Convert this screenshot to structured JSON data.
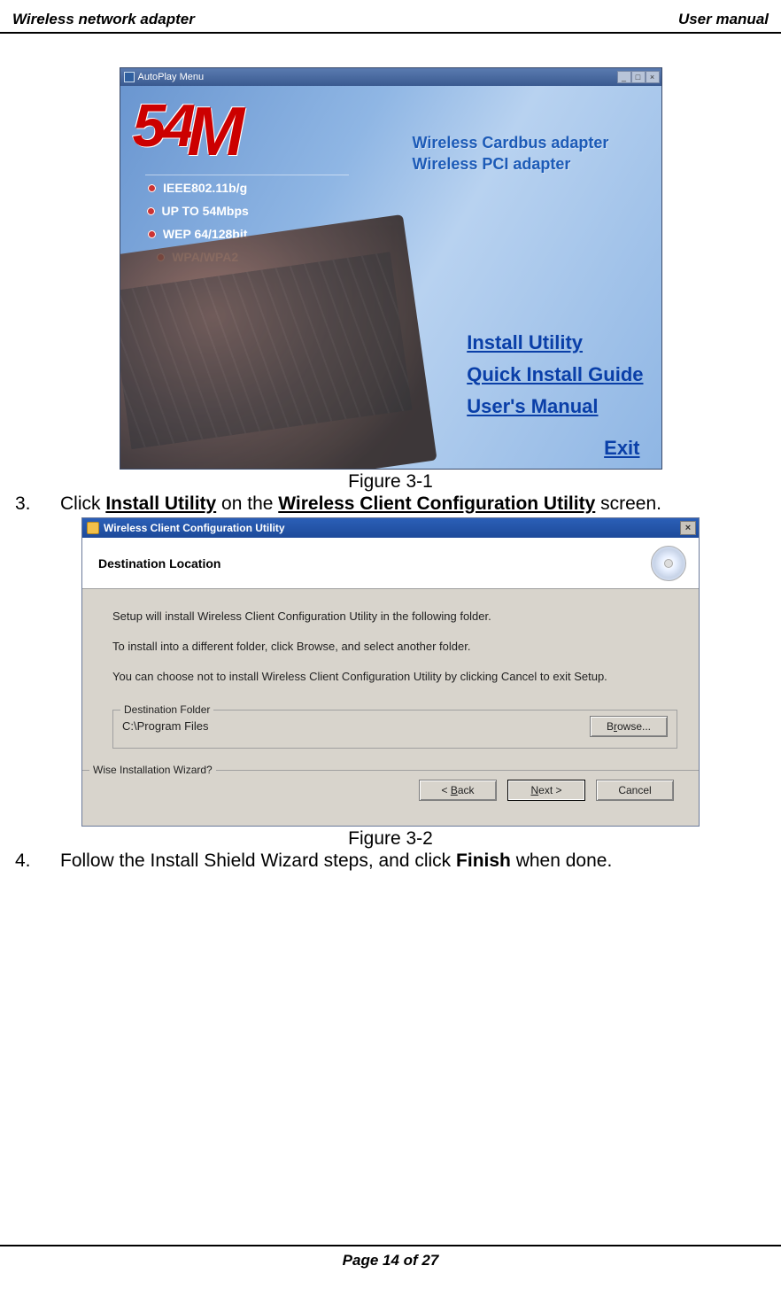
{
  "header": {
    "left": "Wireless network adapter",
    "right": "User manual"
  },
  "footer": "Page 14 of 27",
  "fig1": {
    "titlebar": "AutoPlay Menu",
    "sub1": "Wireless Cardbus adapter",
    "sub2": "Wireless PCI adapter",
    "specs": [
      "IEEE802.11b/g",
      "UP TO 54Mbps",
      "WEP 64/128bit",
      "WPA/WPA2"
    ],
    "links": [
      "Install Utility",
      "Quick Install Guide",
      "User's Manual"
    ],
    "exit": "Exit",
    "caption": "Figure 3-1"
  },
  "step3": {
    "num": "3.",
    "pre": "Click ",
    "b1": "Install Utility",
    "mid": " on the ",
    "b2": "Wireless Client Configuration Utility",
    "post": " screen."
  },
  "fig2": {
    "title": "Wireless Client Configuration Utility",
    "hdr": "Destination Location",
    "p1": "Setup will install Wireless Client Configuration Utility in the following folder.",
    "p2": "To install into a different folder, click Browse, and select another folder.",
    "p3": "You can choose not to install Wireless Client Configuration Utility by clicking Cancel to exit Setup.",
    "dest_legend": "Destination Folder",
    "dest_path": "C:\\Program Files",
    "browse_pre": "B",
    "browse_post": "rowse...",
    "wise": "Wise Installation Wizard?",
    "back_pre": "< ",
    "back_u": "B",
    "back_post": "ack",
    "next_u": "N",
    "next_post": "ext >",
    "cancel": "Cancel",
    "caption": "Figure 3-2"
  },
  "step4": {
    "num": "4.",
    "pre": "Follow the Install Shield Wizard steps, and click ",
    "b1": "Finish",
    "post": " when done."
  }
}
